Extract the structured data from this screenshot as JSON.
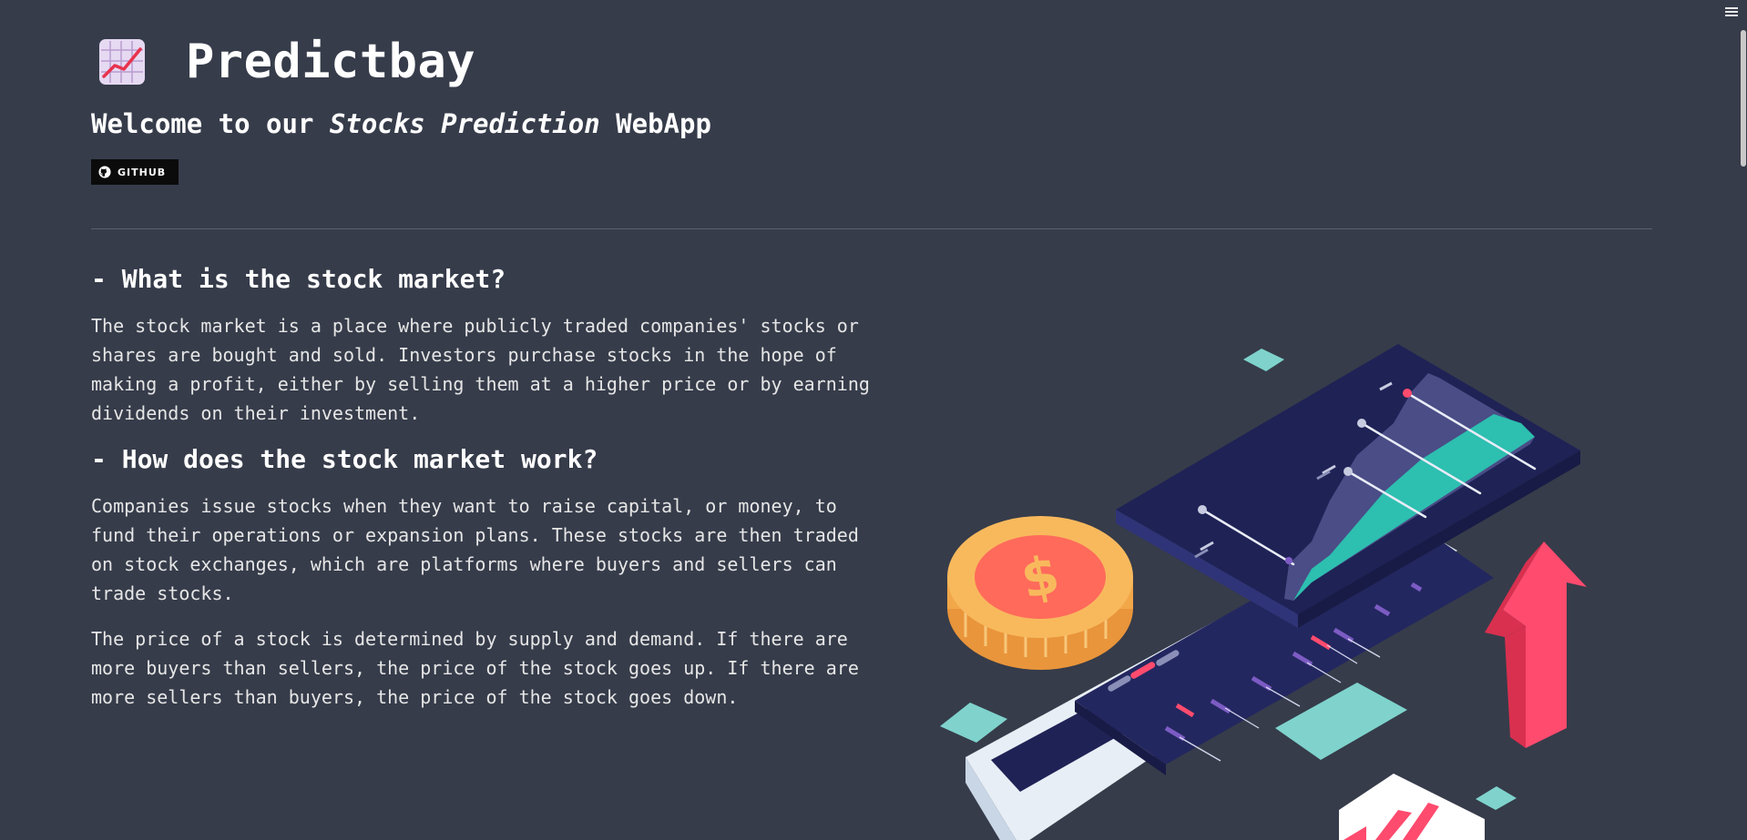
{
  "app": {
    "title": "Predictbay",
    "logo_icon": "chart-increasing-icon"
  },
  "welcome": {
    "prefix": "Welcome to our ",
    "emphasis": "Stocks Prediction",
    "suffix": " WebApp"
  },
  "github_badge": {
    "label": "GITHUB",
    "icon": "github-icon"
  },
  "sections": [
    {
      "heading": "- What is the stock market?",
      "paragraphs": [
        "The stock market is a place where publicly traded companies' stocks or shares are bought and sold. Investors purchase stocks in the hope of making a profit, either by selling them at a higher price or by earning dividends on their investment."
      ]
    },
    {
      "heading": "- How does the stock market work?",
      "paragraphs": [
        "Companies issue stocks when they want to raise capital, or money, to fund their operations or expansion plans. These stocks are then traded on stock exchanges, which are platforms where buyers and sellers can trade stocks.",
        "The price of a stock is determined by supply and demand. If there are more buyers than sellers, the price of the stock goes up. If there are more sellers than buyers, the price of the stock goes down."
      ]
    }
  ],
  "colors": {
    "background": "#363c4a",
    "accent_teal": "#2dbfb0",
    "accent_pink": "#ff4b6e",
    "coin": "#f7b955",
    "screen_navy": "#1f2255"
  }
}
